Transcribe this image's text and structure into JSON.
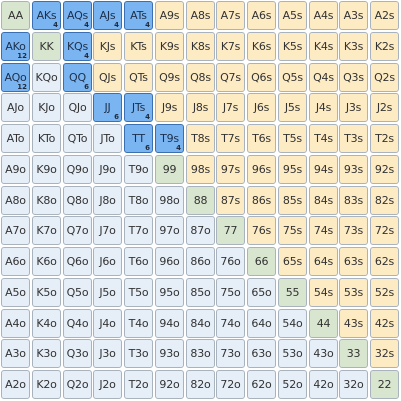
{
  "grid": {
    "ranks": [
      "A",
      "K",
      "Q",
      "J",
      "T",
      "9",
      "8",
      "7",
      "6",
      "5",
      "4",
      "3",
      "2"
    ],
    "cells": [
      [
        "AA",
        "AKs",
        "AQs",
        "AJs",
        "ATs",
        "A9s",
        "A8s",
        "A7s",
        "A6s",
        "A5s",
        "A4s",
        "A3s",
        "A2s"
      ],
      [
        "AKo",
        "KK",
        "KQs",
        "KJs",
        "KTs",
        "K9s",
        "K8s",
        "K7s",
        "K6s",
        "K5s",
        "K4s",
        "K3s",
        "K2s"
      ],
      [
        "AQo",
        "KQo",
        "QQ",
        "QJs",
        "QTs",
        "Q9s",
        "Q8s",
        "Q7s",
        "Q6s",
        "Q5s",
        "Q4s",
        "Q3s",
        "Q2s"
      ],
      [
        "AJo",
        "KJo",
        "QJo",
        "JJ",
        "JTs",
        "J9s",
        "J8s",
        "J7s",
        "J6s",
        "J5s",
        "J4s",
        "J3s",
        "J2s"
      ],
      [
        "ATo",
        "KTo",
        "QTo",
        "JTo",
        "TT",
        "T9s",
        "T8s",
        "T7s",
        "T6s",
        "T5s",
        "T4s",
        "T3s",
        "T2s"
      ],
      [
        "A9o",
        "K9o",
        "Q9o",
        "J9o",
        "T9o",
        "99",
        "98s",
        "97s",
        "96s",
        "95s",
        "94s",
        "93s",
        "92s"
      ],
      [
        "A8o",
        "K8o",
        "Q8o",
        "J8o",
        "T8o",
        "98o",
        "88",
        "87s",
        "86s",
        "85s",
        "84s",
        "83s",
        "82s"
      ],
      [
        "A7o",
        "K7o",
        "Q7o",
        "J7o",
        "T7o",
        "97o",
        "87o",
        "77",
        "76s",
        "75s",
        "74s",
        "73s",
        "72s"
      ],
      [
        "A6o",
        "K6o",
        "Q6o",
        "J6o",
        "T6o",
        "96o",
        "86o",
        "76o",
        "66",
        "65s",
        "64s",
        "63s",
        "62s"
      ],
      [
        "A5o",
        "K5o",
        "Q5o",
        "J5o",
        "T5o",
        "95o",
        "85o",
        "75o",
        "65o",
        "55",
        "54s",
        "53s",
        "52s"
      ],
      [
        "A4o",
        "K4o",
        "Q4o",
        "J4o",
        "T4o",
        "94o",
        "84o",
        "74o",
        "64o",
        "54o",
        "44",
        "43s",
        "42s"
      ],
      [
        "A3o",
        "K3o",
        "Q3o",
        "J3o",
        "T3o",
        "93o",
        "83o",
        "73o",
        "63o",
        "53o",
        "43o",
        "33",
        "32s"
      ],
      [
        "A2o",
        "K2o",
        "Q2o",
        "J2o",
        "T2o",
        "92o",
        "82o",
        "72o",
        "62o",
        "52o",
        "42o",
        "32o",
        "22"
      ]
    ],
    "selected": {
      "AKs": "4",
      "AQs": "4",
      "AJs": "4",
      "ATs": "4",
      "AKo": "12",
      "KQs": "4",
      "AQo": "12",
      "QQ": "6",
      "JJ": "6",
      "JTs": "4",
      "TT": "6",
      "T9s": "4"
    }
  },
  "colors": {
    "pair": "#d9e6cf",
    "suited": "#fdebc4",
    "offsuit": "#e6eef8",
    "selected": "#7ab5f2",
    "selected_border": "#3a6fb0"
  }
}
